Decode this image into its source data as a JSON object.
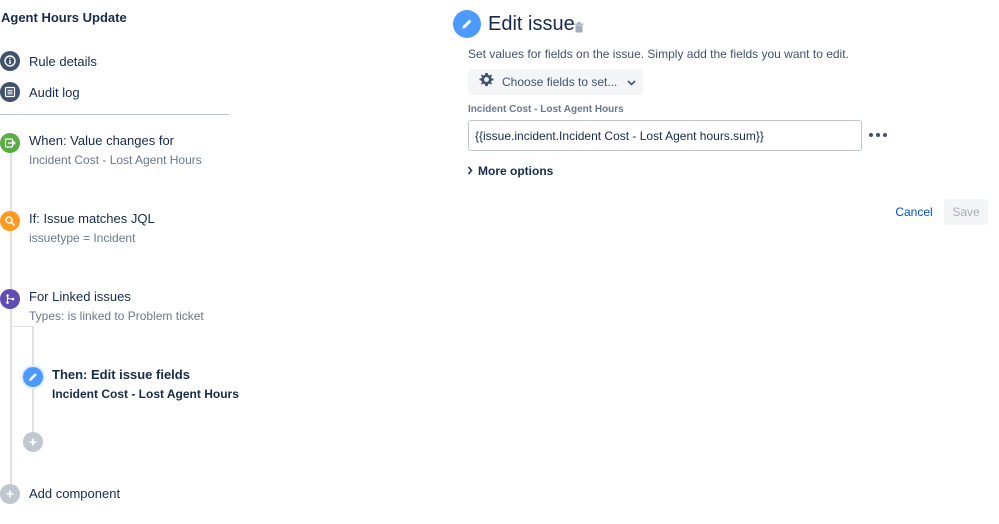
{
  "rule": {
    "title": "Agent Hours Update",
    "meta_items": [
      {
        "label": "Rule details",
        "icon": "info-icon"
      },
      {
        "label": "Audit log",
        "icon": "list-icon"
      }
    ],
    "components": [
      {
        "title": "When: Value changes for",
        "subtitle": "Incident Cost - Lost Agent Hours",
        "icon": "trigger-icon",
        "color": "#5aac44"
      },
      {
        "title": "If: Issue matches JQL",
        "subtitle": "issuetype = Incident",
        "icon": "search-icon",
        "color": "#ff991f"
      },
      {
        "title": "For Linked issues",
        "subtitle": "Types: is linked to Problem ticket",
        "icon": "branch-icon",
        "color": "#5e4db2"
      },
      {
        "title": "Then: Edit issue fields",
        "subtitle": "Incident Cost - Lost Agent Hours",
        "icon": "pencil-icon",
        "color": "#4c9aff"
      }
    ],
    "add_component_label": "Add component"
  },
  "edit": {
    "title": "Edit issue",
    "description": "Set values for fields on the issue. Simply add the fields you want to edit.",
    "choose_fields_label": "Choose fields to set...",
    "field_label": "Incident Cost - Lost Agent Hours",
    "field_value": "{{issue.incident.Incident Cost - Lost Agent hours.sum}}",
    "more_options_label": "More options",
    "cancel_label": "Cancel",
    "save_label": "Save"
  },
  "colors": {
    "accent": "#4c9aff",
    "link": "#0052cc",
    "text": "#172b4d"
  }
}
